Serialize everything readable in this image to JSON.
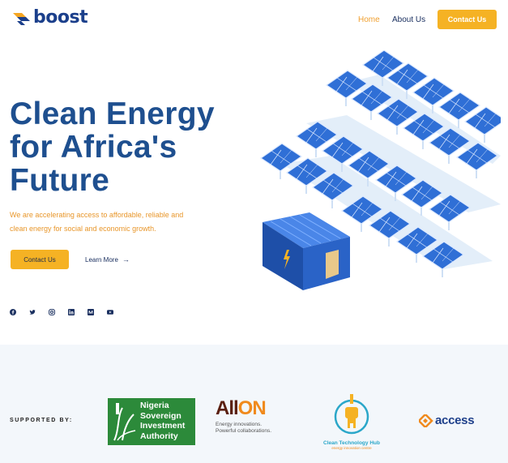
{
  "header": {
    "brand": "boost",
    "nav": {
      "home": "Home",
      "about": "About Us"
    },
    "contact_label": "Contact Us"
  },
  "hero": {
    "title_lines": [
      "Clean Energy",
      "for Africa's",
      "Future"
    ],
    "description_lines": [
      "We are accelerating access to affordable, reliable and",
      "clean energy for social and economic growth."
    ],
    "contact_label": "Contact Us",
    "learn_more_label": "Learn More",
    "socials": [
      "facebook-icon",
      "twitter-icon",
      "instagram-icon",
      "linkedin-icon",
      "medium-icon",
      "youtube-icon"
    ]
  },
  "supported": {
    "label": "SUPPORTED BY:",
    "nsia_lines": [
      "Nigeria",
      "Sovereign",
      "Investment",
      "Authority"
    ],
    "allon": {
      "word_a": "All",
      "word_b": "ON",
      "tag_lines": [
        "Energy innovations.",
        "Powerful collaborations."
      ]
    },
    "cth": {
      "name": "Clean Technology Hub",
      "sub": "energy innovation centre"
    },
    "access": "access"
  },
  "colors": {
    "brand_blue": "#1e4f8f",
    "accent_yellow": "#f5b224",
    "accent_orange": "#e8962a",
    "band_bg": "#f3f7fb"
  }
}
